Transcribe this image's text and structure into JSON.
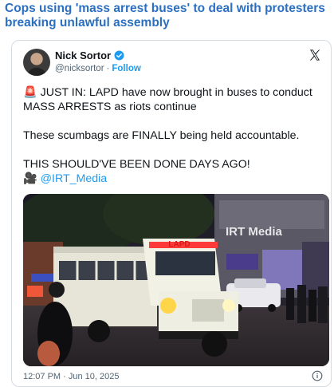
{
  "headline": "Cops using 'mass arrest buses' to deal with protesters breaking unlawful assembly",
  "tweet": {
    "author_name": "Nick Sortor",
    "handle": "@nicksortor",
    "separator": "·",
    "follow_label": "Follow",
    "line1_emoji": "🚨",
    "line1_text": "JUST IN: LAPD have now brought in buses to conduct MASS ARRESTS as riots continue",
    "line2": "These scumbags are FINALLY being held accountable.",
    "line3": "THIS SHOULD'VE BEEN DONE DAYS AGO!",
    "credit_emoji": "🎥",
    "credit_link": "@IRT_Media",
    "timestamp": "12:07 PM · Jun 10, 2025"
  },
  "media": {
    "watermark": "IRT Media",
    "bus_sign": "LAPD"
  },
  "icons": {
    "verified": "verified-badge-icon",
    "x_logo": "x-logo-icon",
    "info": "info-icon"
  },
  "colors": {
    "headline": "#2b6fc0",
    "link": "#1d9bf0",
    "bus": "#f2f1e6"
  }
}
